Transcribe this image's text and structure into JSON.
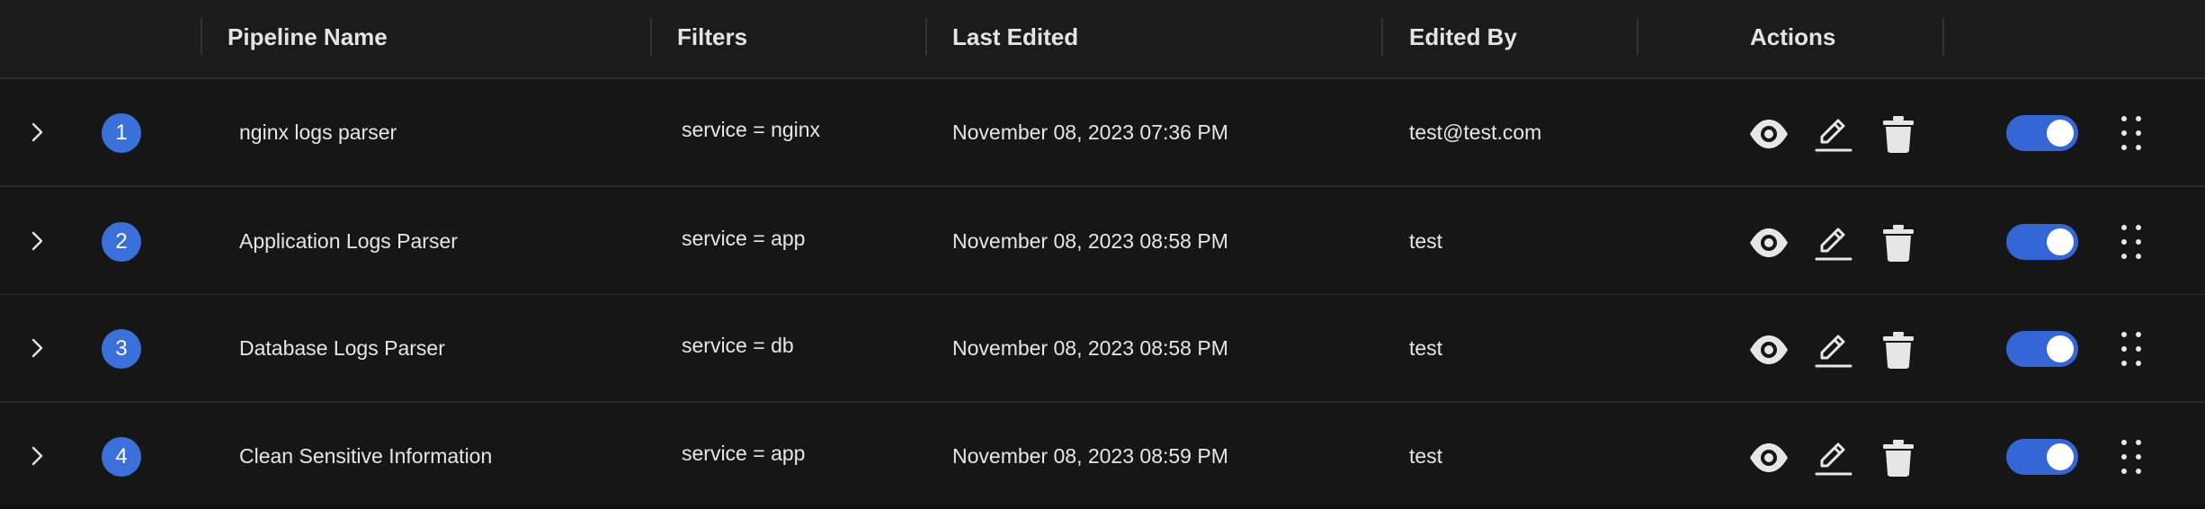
{
  "columns": {
    "pipeline_name": "Pipeline Name",
    "filters": "Filters",
    "last_edited": "Last Edited",
    "edited_by": "Edited By",
    "actions": "Actions"
  },
  "rows": [
    {
      "index": "1",
      "name": "nginx logs parser",
      "filter": "service = nginx",
      "last_edited": "November 08, 2023 07:36 PM",
      "edited_by": "test@test.com",
      "enabled": true
    },
    {
      "index": "2",
      "name": "Application Logs Parser",
      "filter": "service = app",
      "last_edited": "November 08, 2023 08:58 PM",
      "edited_by": "test",
      "enabled": true
    },
    {
      "index": "3",
      "name": "Database Logs Parser",
      "filter": "service = db",
      "last_edited": "November 08, 2023 08:58 PM",
      "edited_by": "test",
      "enabled": true
    },
    {
      "index": "4",
      "name": "Clean Sensitive Information",
      "filter": "service = app",
      "last_edited": "November 08, 2023 08:59 PM",
      "edited_by": "test",
      "enabled": true
    }
  ],
  "icons": {
    "expand": "chevron-right-icon",
    "view": "eye-icon",
    "edit": "pencil-icon",
    "delete": "trash-icon",
    "more": "kebab-menu-icon"
  },
  "colors": {
    "accent": "#3b6fd9",
    "toggle_on": "#3466d6",
    "background": "#161616",
    "header_background": "#1b1b1b"
  }
}
